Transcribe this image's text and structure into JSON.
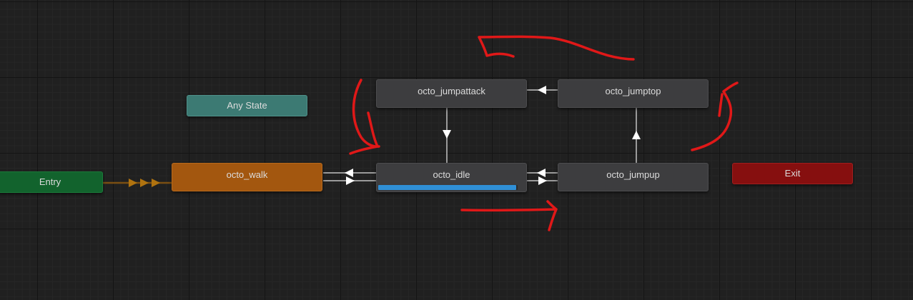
{
  "graph": {
    "states": {
      "entry": "Entry",
      "any_state": "Any State",
      "walk": "octo_walk",
      "idle": "octo_idle",
      "jumpattack": "octo_jumpattack",
      "jumptop": "octo_jumptop",
      "jumpup": "octo_jumpup",
      "exit": "Exit"
    },
    "idle_progress": 0.99,
    "colors": {
      "background": "#202020",
      "entry": "#12632d",
      "any_state": "#3c7a73",
      "default_state": "#a3570f",
      "state": "#3d3d3f",
      "exit": "#860f0f",
      "progress": "#2f8fd6",
      "annotation": "#e01818"
    }
  }
}
